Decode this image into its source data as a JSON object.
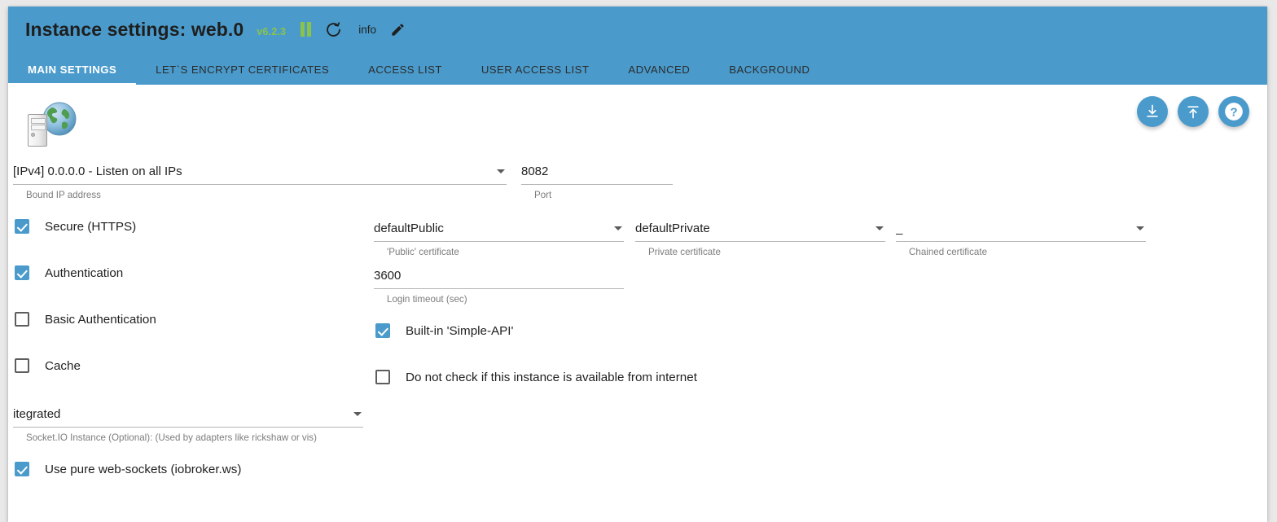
{
  "header": {
    "title": "Instance settings: web.0",
    "version": "v6.2.3",
    "info_label": "info",
    "accent_color": "#4a9bcc",
    "version_color": "#8bc34a",
    "icons": [
      "pause-icon",
      "refresh-icon",
      "edit-icon"
    ]
  },
  "tabs": [
    {
      "label": "MAIN SETTINGS",
      "active": true
    },
    {
      "label": "LET`S ENCRYPT CERTIFICATES",
      "active": false
    },
    {
      "label": "ACCESS LIST",
      "active": false
    },
    {
      "label": "USER ACCESS LIST",
      "active": false
    },
    {
      "label": "ADVANCED",
      "active": false
    },
    {
      "label": "BACKGROUND",
      "active": false
    }
  ],
  "actions": [
    {
      "name": "download-button",
      "icon": "download-icon"
    },
    {
      "name": "upload-button",
      "icon": "upload-icon"
    },
    {
      "name": "help-button",
      "icon": "help-icon"
    }
  ],
  "fields": {
    "bound_ip": {
      "value": "[IPv4] 0.0.0.0 - Listen on all IPs",
      "hint": "Bound IP address"
    },
    "port": {
      "value": "8082",
      "hint": "Port"
    },
    "public_cert": {
      "value": "defaultPublic",
      "hint": "'Public' certificate"
    },
    "private_cert": {
      "value": "defaultPrivate",
      "hint": "Private certificate"
    },
    "chained_cert": {
      "value": "_",
      "hint": "Chained certificate"
    },
    "login_timeout": {
      "value": "3600",
      "hint": "Login timeout (sec)"
    },
    "socketio_instance": {
      "value": "itegrated",
      "hint": "Socket.IO Instance (Optional): (Used by adapters like rickshaw or vis)"
    }
  },
  "checkboxes": {
    "secure_https": {
      "label": "Secure (HTTPS)",
      "checked": true
    },
    "authentication": {
      "label": "Authentication",
      "checked": true
    },
    "basic_authentication": {
      "label": "Basic Authentication",
      "checked": false
    },
    "cache": {
      "label": "Cache",
      "checked": false
    },
    "simple_api": {
      "label": "Built-in 'Simple-API'",
      "checked": true
    },
    "no_internet_check": {
      "label": "Do not check if this instance is available from internet",
      "checked": false
    },
    "pure_websockets": {
      "label": "Use pure web-sockets (iobroker.ws)",
      "checked": true
    }
  }
}
